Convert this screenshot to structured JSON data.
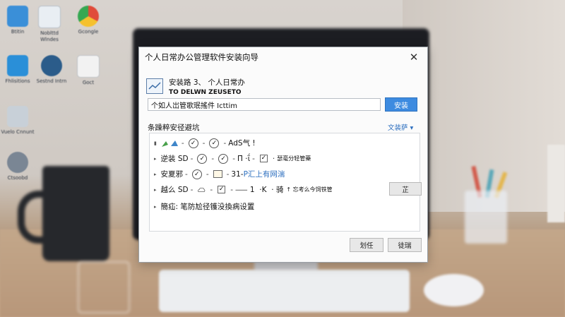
{
  "desktop_icons": [
    {
      "label": "Btitin",
      "color": "#3a8fd8"
    },
    {
      "label": "Noblttd Wlndes",
      "color": "#e9eef3"
    },
    {
      "label": "Gcongle",
      "color": "#e04b3a"
    },
    {
      "label": "Fhlisitions",
      "color": "#2a8fd8"
    },
    {
      "label": "Sestnd Intrn",
      "color": "#2b5c8a"
    },
    {
      "label": "Goct",
      "color": "#f2f2f2"
    },
    {
      "label": "Vuelo Cnnunt",
      "color": "#c8d0d8"
    },
    {
      "label": "Ctsoobd",
      "color": "#7a8694"
    }
  ],
  "dialog": {
    "title": "个人日常办公管理软件安装向导",
    "close_glyph": "✕",
    "step_line1": "安装路 3、  个人日常办",
    "step_line2": "TO DELWN ZEUSETO",
    "path_value": "个如人岀管歌珉搖件 Icttim",
    "install_button": "安装",
    "section_label": "条躁粹安径避坑",
    "options_link": "文装萨",
    "options_link_caret": "▾",
    "rows": {
      "r1_text": "·ȃ.Ȝ·!",
      "r1_end": "AdS气 !",
      "r2_lead": "逆装 SD",
      "r2_mid": "Π̄  ⋅ΐ",
      "r2_small": "瑟毫分轻管藥",
      "r3_lead": "安夏邪",
      "r3_mid": "31- ",
      "r3_blue": "P汇上有网湍",
      "r4_lead": "越么 SD",
      "r4_mid": "⸺ 1  ·K  · 骑",
      "r4_small": "↑ 忘考么今饲铁管",
      "r5_text": "簡疝: 笔防尬径镬没換病设置"
    },
    "side_button": "芷",
    "footer_prev": "划任",
    "footer_next": "徒瑞"
  }
}
